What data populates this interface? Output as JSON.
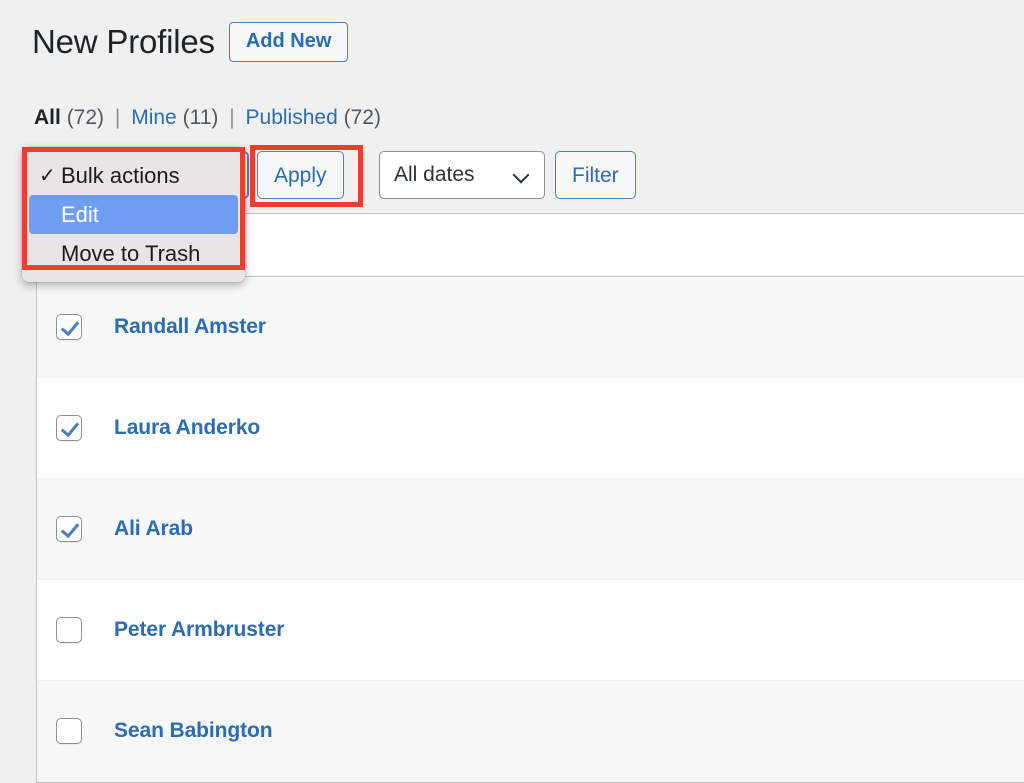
{
  "header": {
    "title": "New Profiles",
    "add_new_label": "Add New"
  },
  "views": {
    "all_label": "All",
    "all_count": "(72)",
    "mine_label": "Mine",
    "mine_count": "(11)",
    "published_label": "Published",
    "published_count": "(72)",
    "separator": "|"
  },
  "toolbar": {
    "bulk_actions_value": "Bulk actions",
    "apply_label": "Apply",
    "date_filter_value": "All dates",
    "filter_label": "Filter"
  },
  "bulk_actions_menu": {
    "options": [
      {
        "label": "Bulk actions",
        "checked": true,
        "highlighted": false
      },
      {
        "label": "Edit",
        "checked": false,
        "highlighted": true
      },
      {
        "label": "Move to Trash",
        "checked": false,
        "highlighted": false
      }
    ],
    "checkmark": "✓"
  },
  "table": {
    "rows": [
      {
        "title": "Randall Amster",
        "checked": true,
        "stripe": "alt"
      },
      {
        "title": "Laura Anderko",
        "checked": true,
        "stripe": "plain"
      },
      {
        "title": "Ali Arab",
        "checked": true,
        "stripe": "alt"
      },
      {
        "title": "Peter Armbruster",
        "checked": false,
        "stripe": "plain"
      },
      {
        "title": "Sean Babington",
        "checked": false,
        "stripe": "alt"
      }
    ]
  },
  "colors": {
    "page_background": "#f0f0f1",
    "link_blue": "#2b6cb4",
    "annotation_red": "#e8402a",
    "menu_highlight_blue": "#6f9df1",
    "row_alt": "#f6f7f7"
  }
}
